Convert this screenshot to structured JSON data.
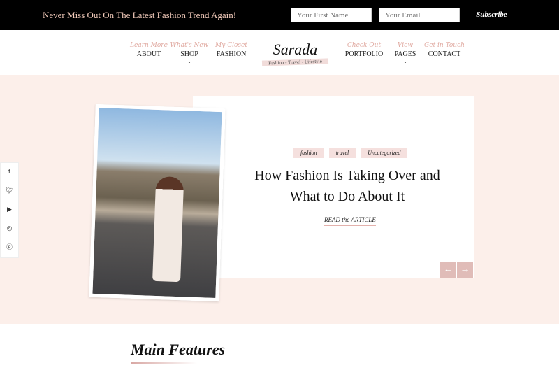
{
  "topbar": {
    "message": "Never Miss Out On The Latest Fashion Trend Again!",
    "first_name_placeholder": "Your First Name",
    "email_placeholder": "Your Email",
    "subscribe": "Subscribe"
  },
  "nav": [
    {
      "small": "Learn More",
      "label": "ABOUT"
    },
    {
      "small": "What's New",
      "label": "SHOP",
      "dropdown": true
    },
    {
      "small": "My Closet",
      "label": "FASHION"
    },
    {
      "small": "Check Out",
      "label": "PORTFOLIO"
    },
    {
      "small": "View",
      "label": "PAGES",
      "dropdown": true
    },
    {
      "small": "Get in Touch",
      "label": "CONTACT"
    }
  ],
  "logo": {
    "name": "Sarada",
    "tagline": "Fashion - Travel - Lifestyle"
  },
  "hero": {
    "tags": [
      "fashion",
      "travel",
      "Uncategorized"
    ],
    "title_line1": "How Fashion Is Taking Over and",
    "title_line2": "What to Do About It",
    "read": "READ the ARTICLE",
    "prev": "←",
    "next": "→"
  },
  "social": [
    "facebook-icon",
    "twitter-icon",
    "youtube-icon",
    "instagram-icon",
    "pinterest-icon"
  ],
  "section": {
    "title": "Main Features"
  }
}
